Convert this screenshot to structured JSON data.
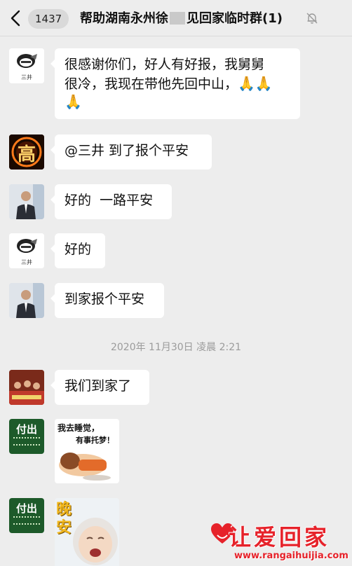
{
  "header": {
    "unread_count": "1437",
    "title_prefix": "帮助湖南永州徐",
    "title_suffix": "见回家临时群(1)"
  },
  "messages": [
    {
      "sender": "三井",
      "text_line1": "很感谢你们，好人有好报，我舅舅",
      "text_line2": "很冷，我现在带他先回中山，",
      "emoji": "🙏"
    },
    {
      "sender": "高",
      "text": "@三井 到了报个平安"
    },
    {
      "text": "好的  一路平安"
    },
    {
      "sender": "三井",
      "text": "好的"
    },
    {
      "text": "到家报个平安"
    },
    {
      "text": "我们到家了"
    }
  ],
  "timestamp": "2020年 11月30日 凌晨 2:21",
  "avatars": {
    "sanjing_label": "三井",
    "gao_label": "高",
    "fuchu_label": "付出"
  },
  "stickers": {
    "sleep_line1": "我去睡觉，",
    "sleep_line2": "有事托梦！",
    "goodnight": "晚安"
  },
  "watermark": {
    "title": "让爱回家",
    "url": "www.rangaihuijia.com"
  },
  "colors": {
    "background": "#ededed",
    "bubble": "#ffffff",
    "accent_red": "#e6222a"
  }
}
